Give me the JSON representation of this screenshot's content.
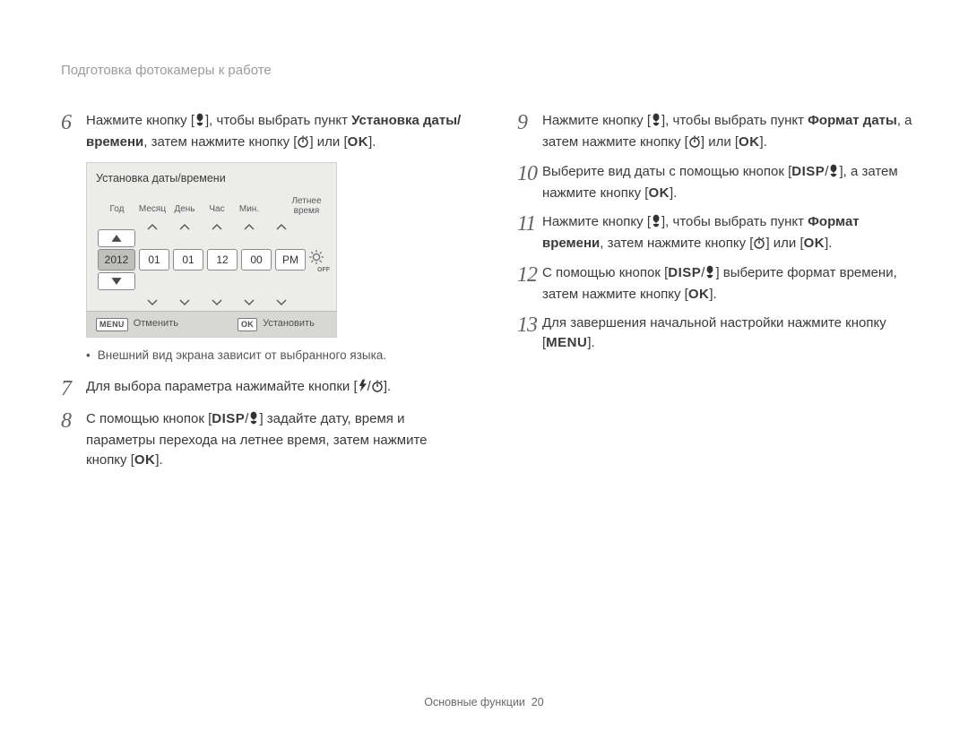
{
  "header": "Подготовка фотокамеры к работе",
  "footer": {
    "section": "Основные функции",
    "page": "20"
  },
  "tokens": {
    "ok": "OK",
    "disp": "DISP",
    "menu": "MENU"
  },
  "lcd": {
    "title": "Установка даты/времени",
    "labels": {
      "year": "Год",
      "month": "Месяц",
      "day": "День",
      "hour": "Час",
      "min": "Мин.",
      "dst": "Летнее\nвремя"
    },
    "values": {
      "year": "2012",
      "month": "01",
      "day": "01",
      "hour": "12",
      "min": "00",
      "ampm": "PM"
    },
    "bar": {
      "menu": "MENU",
      "cancel": "Отменить",
      "ok": "OK",
      "set": "Установить"
    }
  },
  "note_bullet": "Внешний вид экрана зависит от выбранного языка.",
  "left_steps": {
    "6": {
      "pre": "Нажмите кнопку [",
      "mid1": "], чтобы выбрать пункт ",
      "bold": "Установка даты/времени",
      "post": ", затем нажмите кнопку [",
      "sep": "] или [",
      "end": "]."
    },
    "7": {
      "pre": "Для выбора параметра нажимайте кнопки [",
      "sep": "/",
      "post": "]."
    },
    "8": {
      "pre": "С помощью кнопок [",
      "sep": "/",
      "mid": "] задайте дату, время и параметры перехода на летнее время, затем нажмите кнопку [",
      "end": "]."
    }
  },
  "right_steps": {
    "9": {
      "pre": "Нажмите кнопку [",
      "mid1": "], чтобы выбрать пункт ",
      "bold": "Формат даты",
      "post": ", а затем нажмите кнопку [",
      "sep": "] или [",
      "end": "]."
    },
    "10": {
      "pre": "Выберите вид даты с помощью кнопок [",
      "sep": "/",
      "mid": "], а затем нажмите кнопку [",
      "end": "]."
    },
    "11": {
      "pre": "Нажмите кнопку [",
      "mid1": "], чтобы выбрать пункт ",
      "bold": "Формат времени",
      "post": ", затем нажмите кнопку [",
      "sep": "] или [",
      "end": "]."
    },
    "12": {
      "pre": "С помощью кнопок [",
      "sep": "/",
      "mid": "] выберите формат времени, затем нажмите кнопку [",
      "end": "]."
    },
    "13": {
      "pre": "Для завершения начальной настройки нажмите кнопку [",
      "end": "]."
    }
  }
}
